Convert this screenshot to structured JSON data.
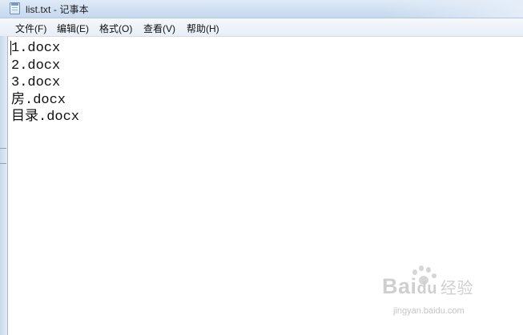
{
  "window": {
    "title": "list.txt - 记事本"
  },
  "menu": {
    "file": "文件(F)",
    "edit": "编辑(E)",
    "format": "格式(O)",
    "view": "查看(V)",
    "help": "帮助(H)"
  },
  "editor": {
    "lines": [
      "1.docx",
      "2.docx",
      "3.docx",
      "房.docx",
      "目录.docx"
    ]
  },
  "watermark": {
    "brand_latin": "Bai",
    "brand_du": "du",
    "brand_cn": "经验",
    "url": "jingyan.baidu.com"
  },
  "colors": {
    "titlebar": "#d3e2f3",
    "menubar": "#eef2f8",
    "editor_bg": "#ffffff",
    "text": "#111111"
  }
}
